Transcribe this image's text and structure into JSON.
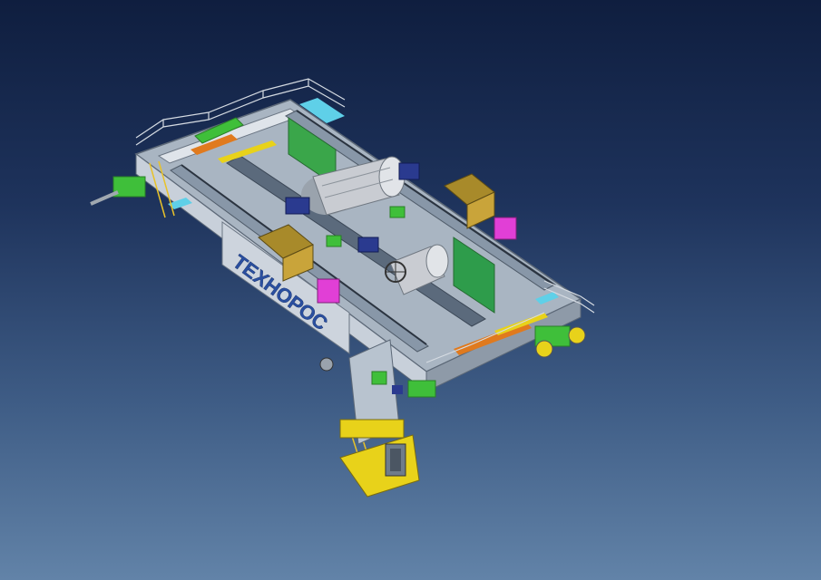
{
  "scene": {
    "subject": "crane-trolley-cad-model",
    "brand_label": "ТЕХНОРОС",
    "colors": {
      "background_top": "#0f1e3f",
      "background_bottom": "#6283a8",
      "frame": "#b8c3cf",
      "frame_dark": "#6f7c8b",
      "drum": "#c9ccd2",
      "green": "#3fbf3a",
      "yellow": "#e8d21a",
      "orange": "#e07a1e",
      "olive": "#a88a2a",
      "magenta": "#e13fd6",
      "cyan": "#5fd0e8",
      "navy": "#2a3a8f",
      "brand_text": "#2a4fa0"
    }
  }
}
